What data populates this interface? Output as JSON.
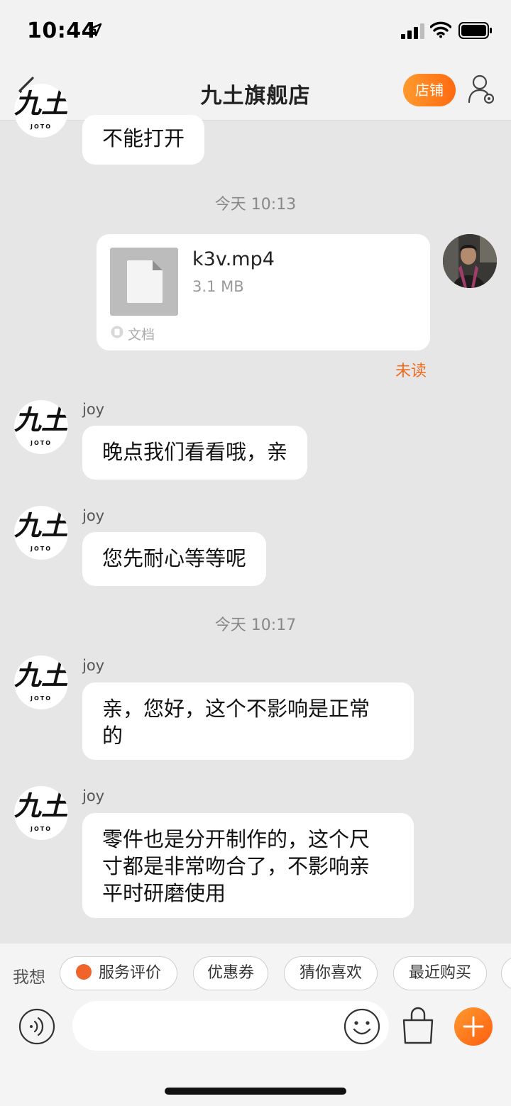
{
  "status_bar": {
    "time": "10:44"
  },
  "nav": {
    "title": "九土旗舰店",
    "shop_button": "店铺"
  },
  "brand_avatar": {
    "logo_main": "九土",
    "logo_sub": "JOTO"
  },
  "messages": {
    "m0": {
      "text": "不能打开"
    },
    "ts1": "今天 10:13",
    "file": {
      "name": "k3v.mp4",
      "size": "3.1 MB",
      "type_label": "文档",
      "status": "未读"
    },
    "m1": {
      "sender": "joy",
      "text": "晚点我们看看哦，亲"
    },
    "m2": {
      "sender": "joy",
      "text": "您先耐心等等呢"
    },
    "ts2": "今天 10:17",
    "m3": {
      "sender": "joy",
      "line1": "亲，您好，这个不影响是正常",
      "line2": "的"
    },
    "m4": {
      "sender": "joy",
      "line1": "零件也是分开制作的，这个尺",
      "line2": "寸都是非常吻合了，不影响亲",
      "line3": "平时研磨使用"
    }
  },
  "quick_bar": {
    "label": "我想",
    "chips": [
      "服务评价",
      "优惠券",
      "猜你喜欢",
      "最近购买"
    ]
  },
  "input": {
    "value": "",
    "placeholder": ""
  },
  "colors": {
    "accent": "#ff6a10",
    "unread": "#f06a20",
    "chat_bg": "#e6e6e6"
  }
}
